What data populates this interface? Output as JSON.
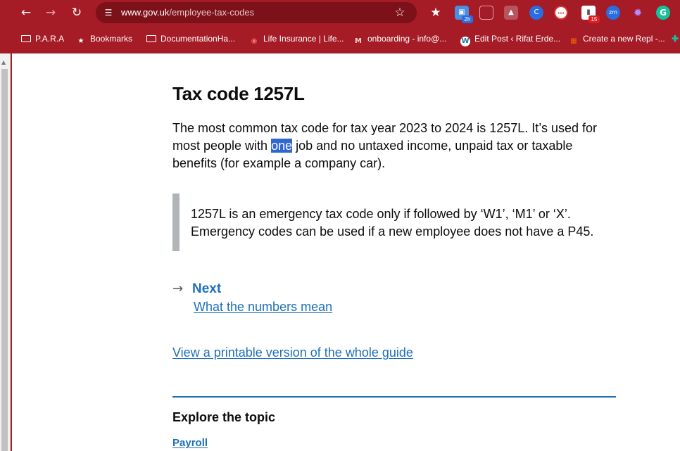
{
  "browser": {
    "url_host": "www.gov.uk",
    "url_path": "/employee-tax-codes",
    "nav": {
      "back_icon": "arrow-left-icon",
      "forward_icon": "arrow-right-icon",
      "reload_icon": "reload-icon"
    },
    "extensions": [
      {
        "icon": "tab-group-icon",
        "badge": "2h",
        "color": "#4a8fe0"
      },
      {
        "icon": "screenshot-icon",
        "badge": "",
        "color": "#b8545c"
      },
      {
        "icon": "image-icon",
        "badge": "",
        "color": "#b8545c"
      },
      {
        "icon": "c-extension-icon",
        "badge": "",
        "color": "#2a6de0"
      },
      {
        "icon": "dots-extension-icon",
        "badge": "",
        "color": "#e03030"
      },
      {
        "icon": "tag-extension-icon",
        "badge": "15",
        "color": "#ffffff"
      },
      {
        "icon": "zm-extension-icon",
        "badge": "",
        "color": "#2a6de0"
      },
      {
        "icon": "puzzle-icon",
        "badge": "",
        "color": "#8a5ce0"
      },
      {
        "icon": "grammarly-icon",
        "badge": "",
        "color": "#15c39a"
      }
    ],
    "bookmarks": [
      {
        "label": "P.A.R.A",
        "icon": "folder-icon"
      },
      {
        "label": "Bookmarks",
        "icon": "star-icon"
      },
      {
        "label": "DocumentationHa...",
        "icon": "folder-icon"
      },
      {
        "label": "Life Insurance | Life...",
        "icon": "globe-icon"
      },
      {
        "label": "onboarding - info@...",
        "icon": "gmail-icon"
      },
      {
        "label": "Edit Post ‹ Rifat Erde...",
        "icon": "wordpress-icon"
      },
      {
        "label": "Create a new Repl -...",
        "icon": "replit-icon"
      }
    ]
  },
  "page": {
    "title": "Tax code 1257L",
    "intro_before": "The most common tax code for tax year 2023 to 2024 is 1257L. It’s used for most people with ",
    "intro_highlight": "one",
    "intro_after": " job and no untaxed income, unpaid tax or taxable benefits (for example a company car).",
    "inset_text": "1257L is an emergency tax code only if followed by ‘W1’, ‘M1’ or ‘X’. Emergency codes can be used if a new employee does not have a P45.",
    "next_label": "Next",
    "next_link": "What the numbers mean",
    "print_link": "View a printable version of the whole guide",
    "explore_title": "Explore the topic",
    "topic_link": "Payroll"
  },
  "colors": {
    "chrome": "#a51b26",
    "link": "#1d70b8",
    "text": "#0b0c0c",
    "inset_border": "#b1b4b6"
  }
}
